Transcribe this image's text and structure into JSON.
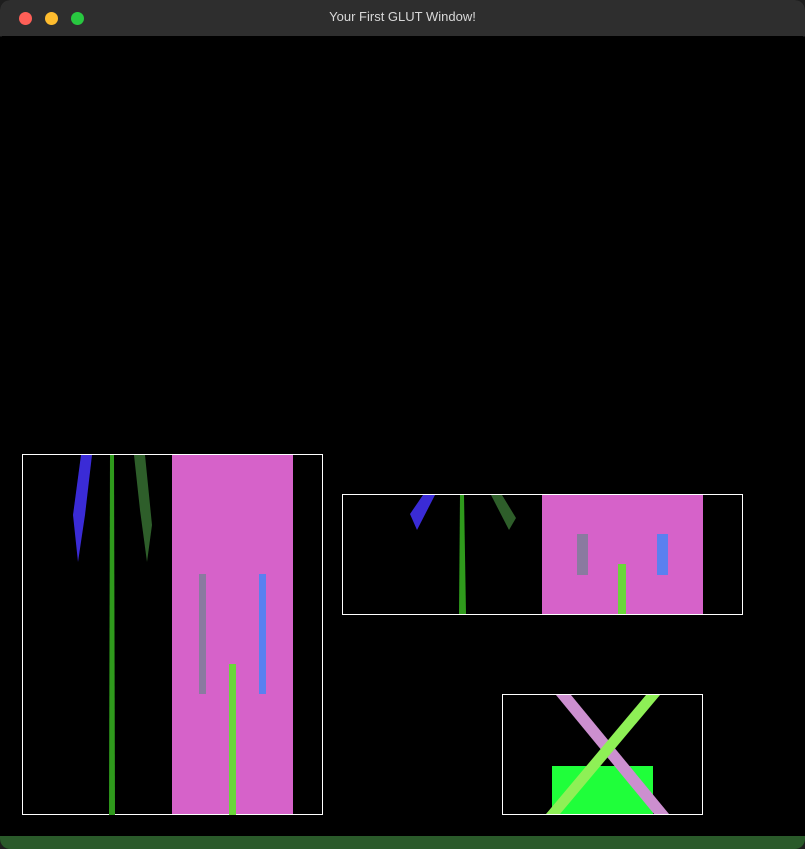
{
  "window": {
    "title": "Your First GLUT Window!",
    "controls": [
      "close",
      "minimize",
      "zoom"
    ]
  },
  "scene": {
    "background": "#000000",
    "frame_color": "#ffffff",
    "colors": {
      "pink": "#d662c9",
      "blue": "#3a2bd6",
      "dark_green": "#2e5e2a",
      "green": "#2f9a1c",
      "gray_purple": "#8a7aa0",
      "light_blue": "#5a80f0",
      "lime": "#6ad63a",
      "bright_green": "#1fff3a",
      "light_pink": "#cc8fcf",
      "light_lime": "#8ef056"
    }
  }
}
